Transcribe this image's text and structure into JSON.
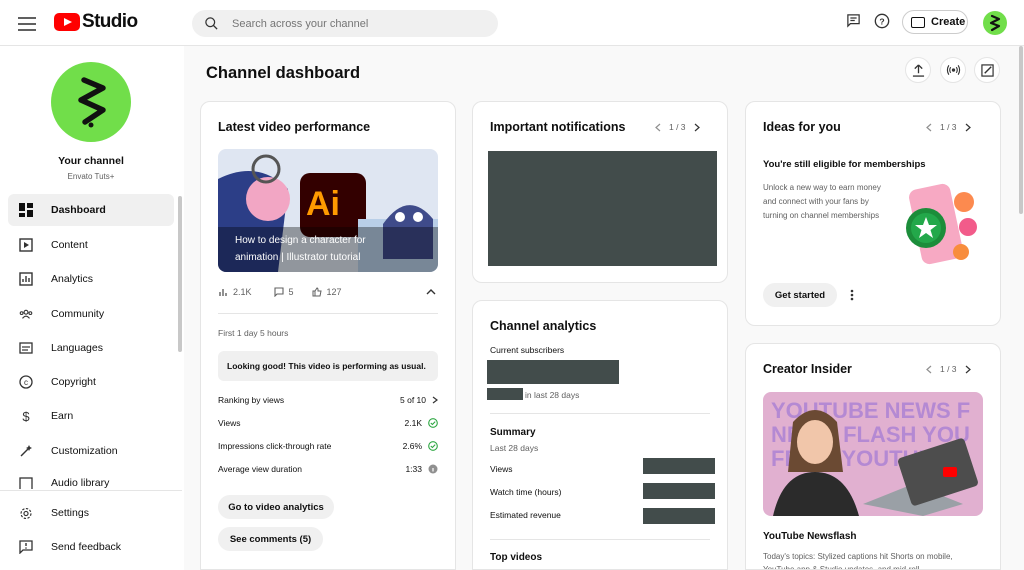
{
  "header": {
    "app_name": "Studio",
    "search_placeholder": "Search across your channel",
    "create_label": "Create"
  },
  "sidebar": {
    "channel_title": "Your channel",
    "channel_name": "Envato Tuts+",
    "items": [
      {
        "label": "Dashboard",
        "icon": "dashboard-icon"
      },
      {
        "label": "Content",
        "icon": "content-icon"
      },
      {
        "label": "Analytics",
        "icon": "analytics-icon"
      },
      {
        "label": "Community",
        "icon": "community-icon"
      },
      {
        "label": "Languages",
        "icon": "languages-icon"
      },
      {
        "label": "Copyright",
        "icon": "copyright-icon"
      },
      {
        "label": "Earn",
        "icon": "earn-icon"
      },
      {
        "label": "Customization",
        "icon": "customization-icon"
      },
      {
        "label": "Audio library",
        "icon": "audio-library-icon"
      }
    ],
    "settings_label": "Settings",
    "feedback_label": "Send feedback"
  },
  "main": {
    "title": "Channel dashboard"
  },
  "latest_video": {
    "card_title": "Latest video performance",
    "video_title_line1": "How to design a character for",
    "video_title_line2": "animation | Illustrator tutorial",
    "views_stat": "2.1K",
    "comments_stat": "5",
    "likes_stat": "127",
    "age": "First 1 day 5 hours",
    "status_message": "Looking good! This video is performing as usual.",
    "metrics": [
      {
        "label": "Ranking by views",
        "value": "5 of 10"
      },
      {
        "label": "Views",
        "value": "2.1K"
      },
      {
        "label": "Impressions click-through rate",
        "value": "2.6%"
      },
      {
        "label": "Average view duration",
        "value": "1:33"
      }
    ],
    "analytics_button": "Go to video analytics",
    "comments_button": "See comments (5)",
    "thumbnail_text": "Ai"
  },
  "notifications": {
    "card_title": "Important notifications",
    "pager": "1 / 3"
  },
  "channel_analytics": {
    "card_title": "Channel analytics",
    "subscribers_label": "Current subscribers",
    "subscribers_period": "in last 28 days",
    "summary_title": "Summary",
    "summary_period": "Last 28 days",
    "summary_rows": [
      "Views",
      "Watch time (hours)",
      "Estimated revenue"
    ],
    "top_videos_title": "Top videos"
  },
  "ideas": {
    "card_title": "Ideas for you",
    "pager": "1 / 3",
    "headline": "You're still eligible for memberships",
    "body": "Unlock a new way to earn money and connect with your fans by turning on channel memberships",
    "button": "Get started"
  },
  "creator_insider": {
    "card_title": "Creator Insider",
    "pager": "1 / 3",
    "thumb_line1": "YOUTUBE NEWS F",
    "thumb_line2": "NEWS FLASH YOU",
    "thumb_line3": "FROM YOUTUBE",
    "video_title": "YouTube Newsflash",
    "video_desc": "Today's topics: Stylized captions hit Shorts on mobile, YouTube app & Studio updates, and mid-roll"
  },
  "colors": {
    "brand_red": "#ff0000",
    "avatar_green": "#71de4a",
    "redacted": "#424c4b",
    "check_green": "#2ba640"
  }
}
